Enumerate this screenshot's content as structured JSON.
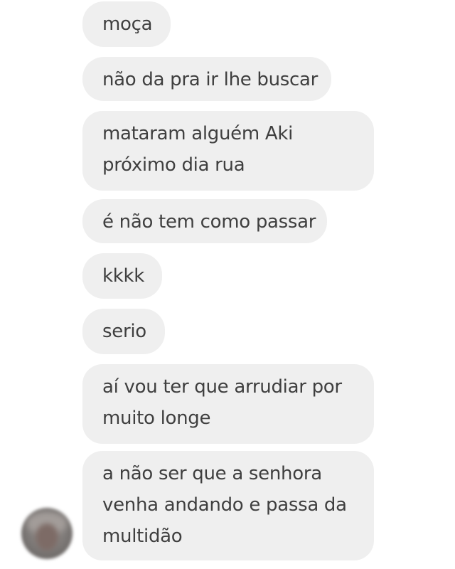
{
  "conversation": {
    "messages": [
      {
        "lines": [
          "moça"
        ]
      },
      {
        "lines": [
          "não da pra ir lhe buscar"
        ]
      },
      {
        "lines": [
          "mataram alguém Aki",
          "próximo dia rua"
        ]
      },
      {
        "lines": [
          "é não tem como passar"
        ]
      },
      {
        "lines": [
          "kkkk"
        ]
      },
      {
        "lines": [
          "serio"
        ]
      },
      {
        "lines": [
          "aí vou ter que arrudiar por",
          "muito longe"
        ]
      },
      {
        "lines": [
          "a não ser que a senhora",
          "venha andando e passa da",
          "multidão"
        ]
      }
    ],
    "sender": {
      "avatar": "blurred-profile-photo"
    }
  },
  "colors": {
    "bubble_bg": "#efefef",
    "text": "#3f3f3f",
    "background": "#ffffff"
  }
}
